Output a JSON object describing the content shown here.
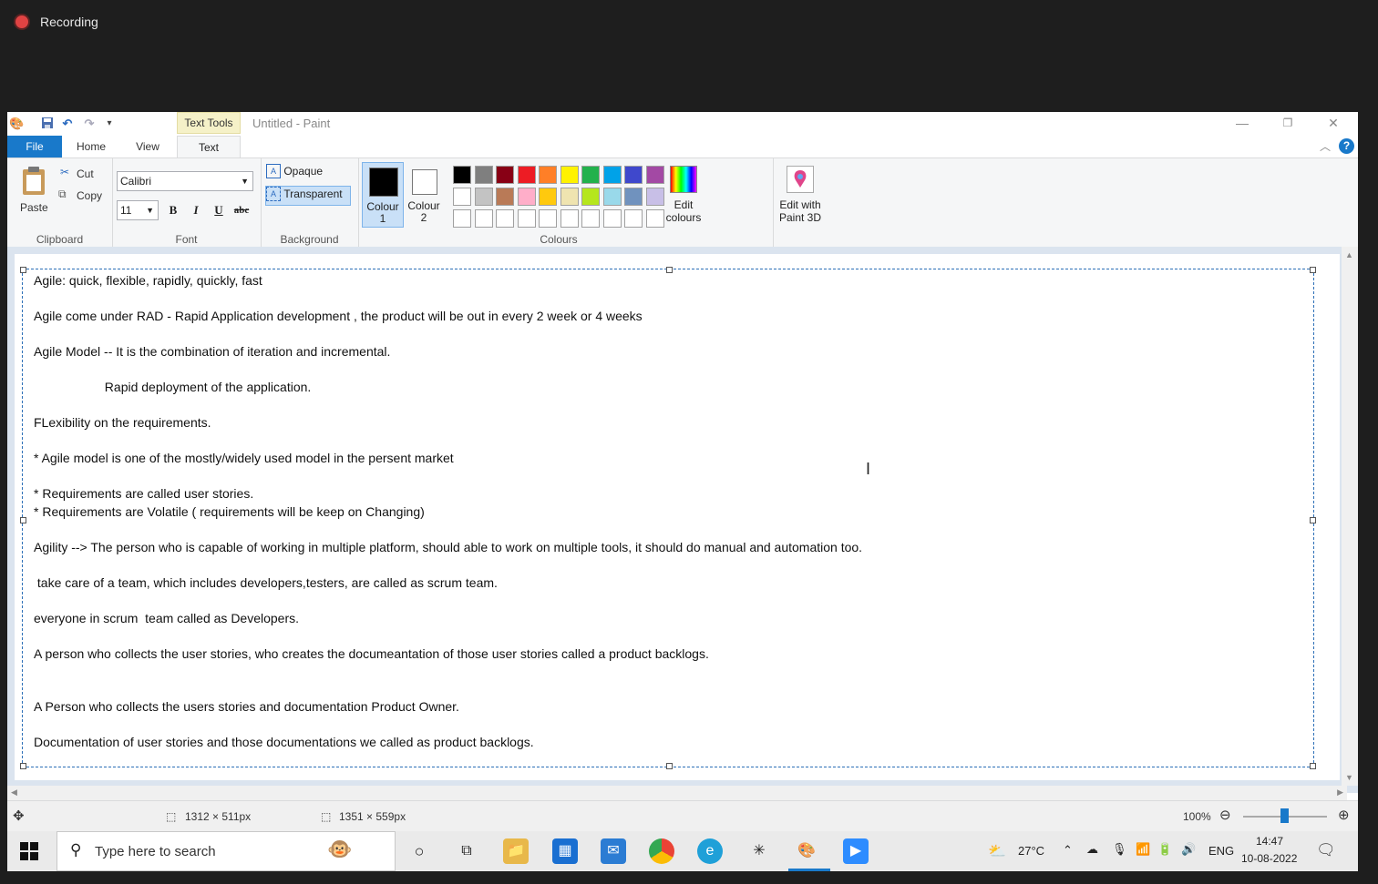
{
  "recording": {
    "label": "Recording"
  },
  "window": {
    "title": "Untitled - Paint",
    "contextual_tab": "Text Tools"
  },
  "tabs": {
    "file": "File",
    "home": "Home",
    "view": "View",
    "text": "Text"
  },
  "ribbon": {
    "clipboard": {
      "paste": "Paste",
      "cut": "Cut",
      "copy": "Copy",
      "label": "Clipboard"
    },
    "font": {
      "family": "Calibri",
      "size": "11",
      "bold": "B",
      "italic": "I",
      "underline": "U",
      "strike": "abc",
      "label": "Font"
    },
    "background": {
      "opaque": "Opaque",
      "transparent": "Transparent",
      "label": "Background"
    },
    "colours": {
      "colour1": "Colour\n1",
      "colour1_a": "Colour",
      "colour1_b": "1",
      "colour2_a": "Colour",
      "colour2_b": "2",
      "edit_a": "Edit",
      "edit_b": "colours",
      "paint3d_a": "Edit with",
      "paint3d_b": "Paint 3D",
      "label": "Colours",
      "palette_row1": [
        "#000000",
        "#7f7f7f",
        "#880015",
        "#ed1c24",
        "#ff7f27",
        "#fff200",
        "#22b14c",
        "#00a2e8",
        "#3f48cc",
        "#a349a4"
      ],
      "palette_row2": [
        "#ffffff",
        "#c3c3c3",
        "#b97a57",
        "#ffaec9",
        "#ffc90e",
        "#efe4b0",
        "#b5e61d",
        "#99d9ea",
        "#7092be",
        "#c8bfe7"
      ]
    }
  },
  "document": {
    "lines": [
      "Agile: quick, flexible, rapidly, quickly, fast",
      "Agile come under RAD - Rapid Application development , the product will be out in every 2 week or 4 weeks",
      "Agile Model -- It is the combination of iteration and incremental.",
      "                    Rapid deployment of the application.",
      "FLexibility on the requirements.",
      "* Agile model is one of the mostly/widely used model in the persent market",
      "* Requirements are called user stories.",
      "* Requirements are Volatile ( requirements will be keep on Changing)",
      "Agility --> The person who is capable of working in multiple platform, should able to work on multiple tools, it should do manual and automation too.",
      " take care of a team, which includes developers,testers, are called as scrum team.",
      "everyone in scrum  team called as Developers.",
      "A person who collects the user stories, who creates the documeantation of those user stories called a product backlogs.",
      "A Person who collects the users stories and documentation Product Owner.",
      "Documentation of user stories and those documentations we called as product backlogs."
    ]
  },
  "statusbar": {
    "selection": "1312 × 511px",
    "canvas": "1351 × 559px",
    "zoom": "100%"
  },
  "taskbar": {
    "search_placeholder": "Type here to search",
    "temperature": "27°C",
    "language": "ENG",
    "time": "14:47",
    "date": "10-08-2022"
  }
}
